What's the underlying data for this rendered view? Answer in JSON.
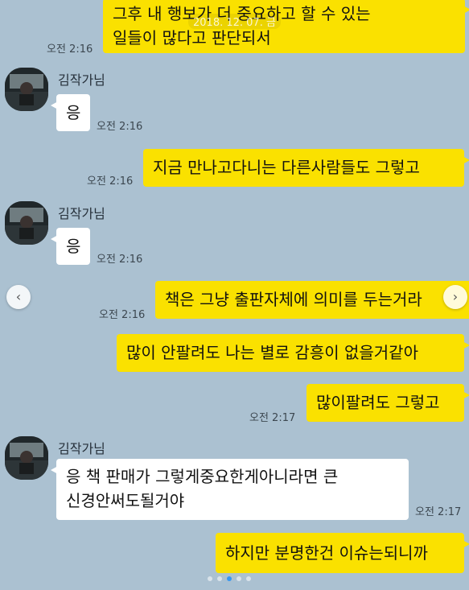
{
  "date_overlay": "2018. 12. 07. 금",
  "sender_name": "김작가님",
  "colors": {
    "background": "#abc1d1",
    "my_bubble": "#fae100",
    "other_bubble": "#ffffff",
    "active_dot": "#3897f0"
  },
  "messages": [
    {
      "from": "me",
      "lines": [
        "그후 내 행보가 더 중요하고 할 수 있는",
        "일들이 많다고 판단되서"
      ],
      "time": "오전 2:16"
    },
    {
      "from": "other",
      "text": "응",
      "time": "오전 2:16"
    },
    {
      "from": "me",
      "text": "지금 만나고다니는 다른사람들도 그렇고",
      "time": "오전 2:16"
    },
    {
      "from": "other",
      "text": "응",
      "time": "오전 2:16"
    },
    {
      "from": "me",
      "text": "책은 그냥 출판자체에 의미를 두는거라",
      "time": "오전 2:16"
    },
    {
      "from": "me",
      "text": "많이 안팔려도 나는 별로 감흥이 없을거같아"
    },
    {
      "from": "me",
      "text": "많이팔려도 그렇고",
      "time": "오전 2:17"
    },
    {
      "from": "other",
      "lines": [
        "응 책 판매가 그렇게중요한게아니라면 큰",
        "신경안써도될거야"
      ],
      "time": "오전 2:17"
    },
    {
      "from": "me",
      "text": "하지만 분명한건 이슈는되니까"
    }
  ],
  "carousel": {
    "prev_icon": "chevron-left-icon",
    "next_icon": "chevron-right-icon",
    "prev_glyph": "‹",
    "next_glyph": "›",
    "page_count": 5,
    "active_index": 2
  }
}
